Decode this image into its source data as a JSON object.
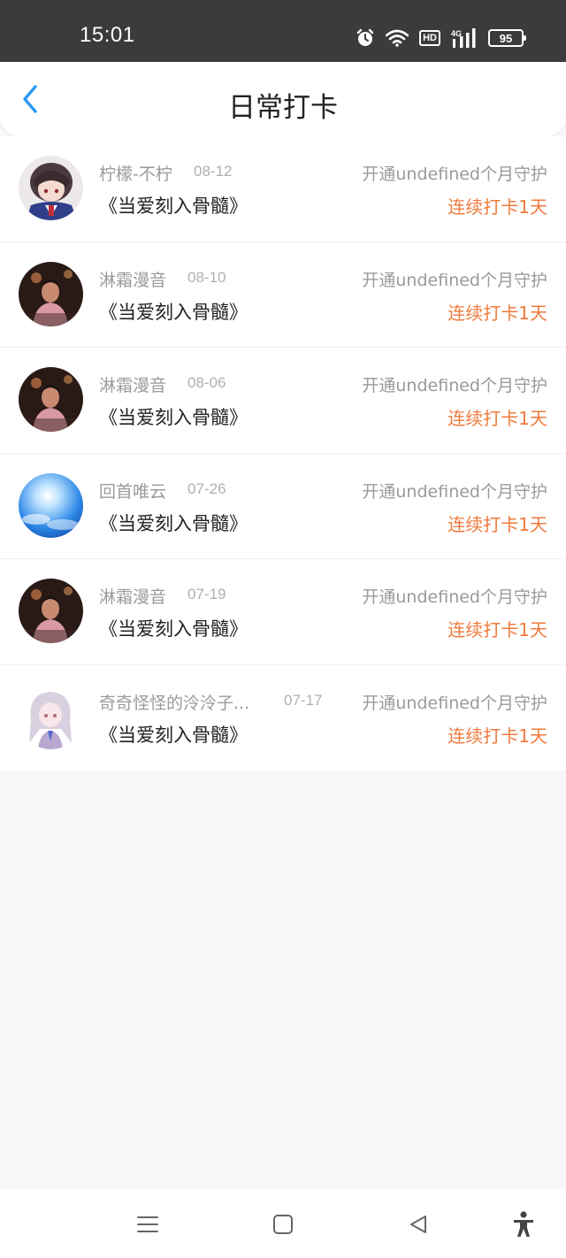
{
  "status_bar": {
    "time": "15:01",
    "network": "4G",
    "hd_label": "HD",
    "battery": "95",
    "icons": [
      "alarm-icon",
      "wifi-icon",
      "hd-icon",
      "signal-icon",
      "battery-icon"
    ]
  },
  "header": {
    "title": "日常打卡",
    "back_icon": "chevron-left-icon",
    "accent": "#2a9af5"
  },
  "colors": {
    "streak": "#f07a3c",
    "muted_text": "#9a9a9a",
    "primary_text": "#222222",
    "status_bar_bg": "#3b3b3b",
    "page_bg": "#f8f6f7"
  },
  "entries": [
    {
      "user": "柠檬-不柠",
      "date": "08-12",
      "song": "《当爱刻入骨髓》",
      "guard": "开通undefined个月守护",
      "streak": "连续打卡1天"
    },
    {
      "user": "淋霜漫音",
      "date": "08-10",
      "song": "《当爱刻入骨髓》",
      "guard": "开通undefined个月守护",
      "streak": "连续打卡1天"
    },
    {
      "user": "淋霜漫音",
      "date": "08-06",
      "song": "《当爱刻入骨髓》",
      "guard": "开通undefined个月守护",
      "streak": "连续打卡1天"
    },
    {
      "user": "回首唯云",
      "date": "07-26",
      "song": "《当爱刻入骨髓》",
      "guard": "开通undefined个月守护",
      "streak": "连续打卡1天"
    },
    {
      "user": "淋霜漫音",
      "date": "07-19",
      "song": "《当爱刻入骨髓》",
      "guard": "开通undefined个月守护",
      "streak": "连续打卡1天"
    },
    {
      "user": "奇奇怪怪的泠泠子...",
      "date": "07-17",
      "song": "《当爱刻入骨髓》",
      "guard": "开通undefined个月守护",
      "streak": "连续打卡1天"
    }
  ],
  "nav_bar": {
    "icons": [
      "menu-icon",
      "home-square-icon",
      "back-triangle-icon",
      "accessibility-icon"
    ]
  }
}
